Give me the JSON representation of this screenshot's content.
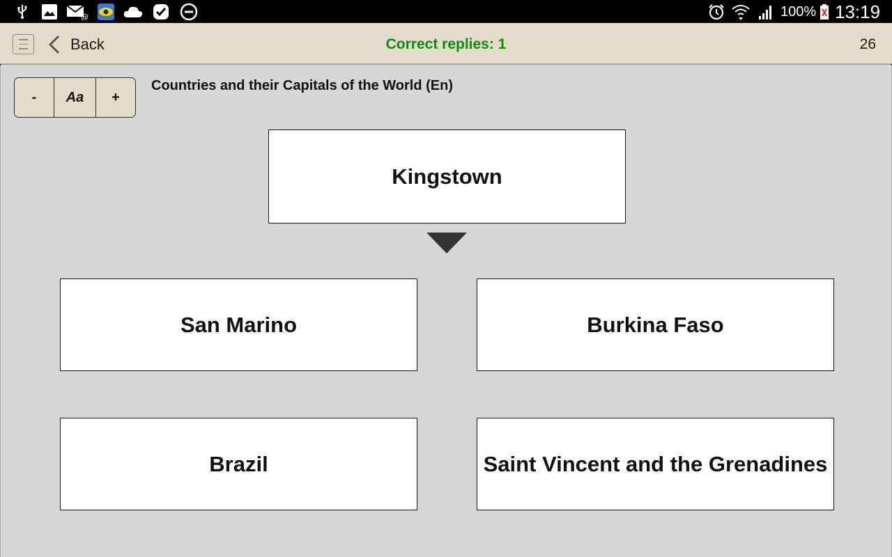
{
  "status_bar": {
    "icons": [
      "usb-icon",
      "gallery-icon",
      "email-icon",
      "app-eye-icon",
      "cloud-icon",
      "check-badge-icon",
      "do-not-disturb-icon",
      "alarm-icon",
      "wifi-icon",
      "signal-icon",
      "battery-icon"
    ],
    "battery": "100%",
    "time": "13:19"
  },
  "header": {
    "back_label": "Back",
    "correct_replies": "Correct replies: 1",
    "counter": "26",
    "correct_color": "#118a0e"
  },
  "font_controls": {
    "decrease": "-",
    "font": "Aa",
    "increase": "+"
  },
  "deck_title": "Countries and their Capitals of the World (En)",
  "question": "Kingstown",
  "answers": [
    "San Marino",
    "Burkina Faso",
    "Brazil",
    "Saint Vincent and the Grenadines"
  ]
}
